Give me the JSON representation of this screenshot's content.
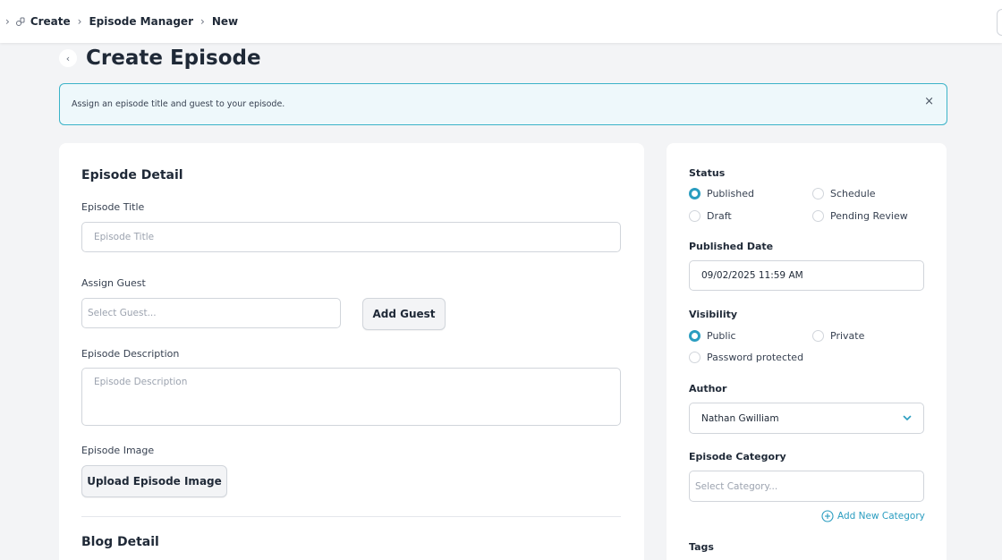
{
  "breadcrumb": {
    "items": [
      "Create",
      "Episode Manager",
      "New"
    ]
  },
  "page": {
    "title": "Create Episode"
  },
  "alert": {
    "message": "Assign an episode title and guest to your episode.",
    "close_icon": "×"
  },
  "episode_detail": {
    "section_title": "Episode Detail",
    "title_label": "Episode Title",
    "title_placeholder": "Episode Title",
    "guest_label": "Assign Guest",
    "guest_placeholder": "Select Guest...",
    "add_guest_label": "Add Guest",
    "description_label": "Episode Description",
    "description_placeholder": "Episode Description",
    "image_label": "Episode Image",
    "upload_label": "Upload Episode Image"
  },
  "blog_detail": {
    "section_title": "Blog Detail"
  },
  "sidebar": {
    "status_label": "Status",
    "status_options": [
      "Published",
      "Schedule",
      "Draft",
      "Pending Review"
    ],
    "status_selected": "Published",
    "published_date_label": "Published Date",
    "published_date_value": "09/02/2025 11:59 AM",
    "visibility_label": "Visibility",
    "visibility_options": [
      "Public",
      "Private",
      "Password protected"
    ],
    "visibility_selected": "Public",
    "author_label": "Author",
    "author_value": "Nathan Gwilliam",
    "category_label": "Episode Category",
    "category_placeholder": "Select Category...",
    "add_category_label": "Add New Category",
    "tags_label": "Tags"
  },
  "colors": {
    "accent": "#2a9dc0",
    "alert_border": "#3bb3c8",
    "alert_bg": "#eef8fb",
    "page_bg": "#f3f4f6"
  }
}
